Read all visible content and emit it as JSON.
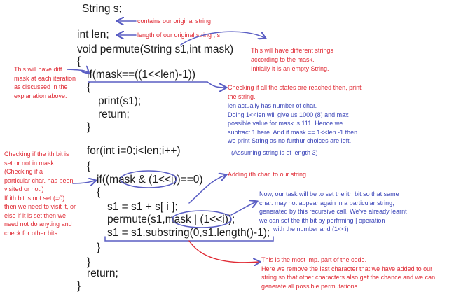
{
  "colors": {
    "code": "#1c1c1c",
    "red_note": "#e02b35",
    "blue_note": "#3a44b8",
    "markup": "#5a5ec4"
  },
  "code": {
    "l1": "String s;",
    "l2": "int len;",
    "l3": "void permute(String s1,int mask)",
    "l4": "{",
    "l5": "if(mask==((1<<len)-1))",
    "l6": "{",
    "l7": "print(s1);",
    "l8": "return;",
    "l9": "}",
    "l10": "for(int i=0;i<len;i++)",
    "l11": "{",
    "l12": "if((mask & (1<<i))==0)",
    "l13": "{",
    "l14": "s1 = s1 + s[ i ];",
    "l15": "permute(s1,mask | (1<<i));",
    "l16": "s1 = s1.substring(0,s1.length()-1);",
    "l17": "}",
    "l18": "}",
    "l19": "return;",
    "l20": "}"
  },
  "notes": {
    "n1": "contains our original string",
    "n2": "length of our original string , s",
    "n3": "This will have different strings\naccording to the mask.\nInitially it is an empty String.",
    "n4": "This will have diff.\nmask at each iteration\nas discussed in the\nexplanation above.",
    "n5": "Checking if all the states are reached then, print\nthe string.",
    "n6": "len actually has number of char.\nDoing 1<<len will give us 1000 (8) and max\npossible value for mask is 111. Hence we\nsubtract 1 here. And if mask == 1<<len -1 then\nwe print String as no furthur choices are left.",
    "n7": "(Assuming string is of length 3)",
    "n8": "Checking if the ith bit is\nset or not in mask.\n(Checking if a\nparticular char. has been\nvisited or not.)\nIf ith bit is not set (=0)\nthen we need to visit it, or\nelse if it is set then we\nneed not do anyting and\ncheck for other bits.",
    "n9": "Adding ith char. to our string",
    "n10": "Now, our task will be to set the ith bit so that same\nchar. may not appear again in a particular string,\ngenerated by this recursive call. We've already learnt\nwe can set the ith bit by perfrming | operation\n        with the number and (1<<i)",
    "n11": "This is the most imp. part of the code.\nHere we remove the last character that we have added to our\nstring so that other characters also get the chance and we can\ngenerate all possible permutations."
  }
}
